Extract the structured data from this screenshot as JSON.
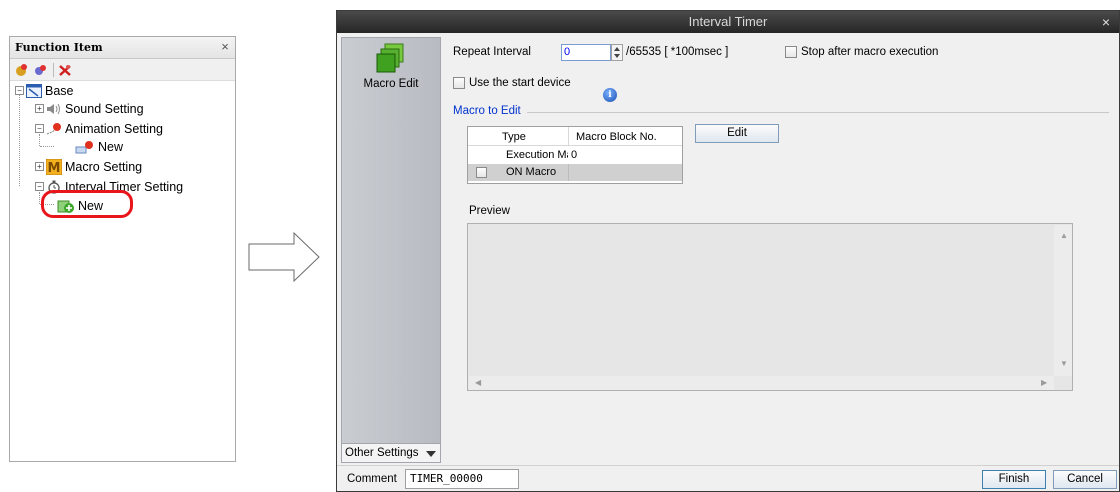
{
  "function_item": {
    "title": "Function Item",
    "close_glyph": "×",
    "toolbar": [
      "add-item-icon",
      "add-child-icon",
      "separator",
      "delete-icon"
    ],
    "tree": [
      {
        "label": "Base",
        "icon": "base-screen-icon"
      },
      {
        "label": "Sound Setting",
        "icon": "speaker-icon"
      },
      {
        "label": "Animation Setting",
        "icon": "animation-icon"
      },
      {
        "label": "New",
        "icon": "animation-new-icon"
      },
      {
        "label": "Macro Setting",
        "icon": "macro-m-icon"
      },
      {
        "label": "Interval Timer Setting",
        "icon": "timer-icon"
      },
      {
        "label": "New",
        "icon": "add-new-icon"
      }
    ],
    "highlight_color": "#e8151b"
  },
  "dialog": {
    "title": "Interval Timer",
    "close_glyph": "×",
    "side": {
      "macro_edit_label": "Macro Edit",
      "other_settings_label": "Other Settings"
    },
    "repeat_interval": {
      "label": "Repeat Interval",
      "value": "0",
      "range_text": "/65535 [ *100msec ]"
    },
    "stop_after_macro": {
      "label": "Stop after macro execution",
      "checked": false
    },
    "use_start_device": {
      "label": "Use the start device",
      "checked": false
    },
    "info_glyph": "i",
    "macro_to_edit": {
      "legend": "Macro to Edit",
      "columns": [
        "Type",
        "Macro Block No."
      ],
      "rows": [
        {
          "type": "Execution Ma",
          "block": "0"
        },
        {
          "type": "ON Macro",
          "block": ""
        }
      ],
      "edit_button": "Edit"
    },
    "preview": {
      "label": "Preview"
    },
    "comment": {
      "label": "Comment",
      "value": "TIMER_00000"
    },
    "buttons": {
      "finish": "Finish",
      "cancel": "Cancel"
    }
  }
}
